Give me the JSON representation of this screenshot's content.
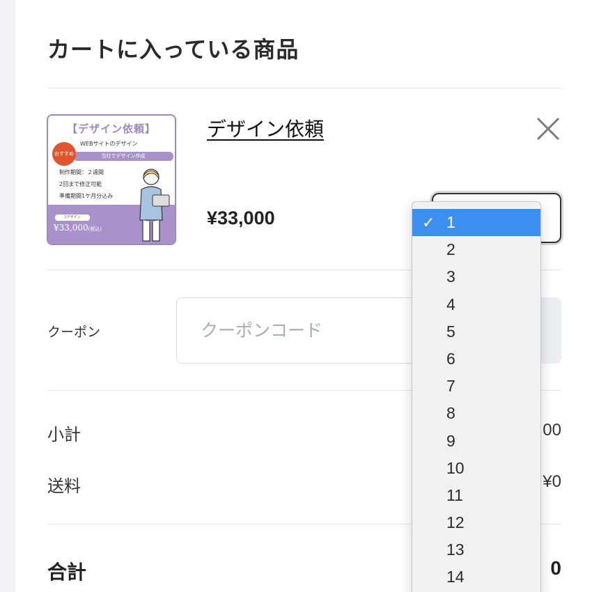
{
  "cart": {
    "title": "カートに入っている商品",
    "item": {
      "name": "デザイン依頼",
      "price": "¥33,000",
      "thumbnail": {
        "title": "【デザイン依頼】",
        "subtitle": "WEBサイトのデザイン",
        "badge": "おすすめ",
        "ribbon": "当社でデザイン作成",
        "line1": "制作期間：２週間",
        "line2": "2回まで修正可能",
        "line3": "準備期間1ケ月分込み",
        "pill": "1デザイン",
        "price": "¥33,000",
        "tax": "(税込)"
      },
      "remove_icon": "close-icon",
      "quantity": {
        "selected": "1",
        "options": [
          "1",
          "2",
          "3",
          "4",
          "5",
          "6",
          "7",
          "8",
          "9",
          "10",
          "11",
          "12",
          "13",
          "14"
        ]
      }
    },
    "coupon": {
      "label": "クーポン",
      "placeholder": "クーポンコード"
    },
    "summary": {
      "subtotal_label": "小計",
      "subtotal_value": "00",
      "shipping_label": "送料",
      "shipping_value": "¥0",
      "total_label": "合計",
      "total_value": "0"
    }
  },
  "colors": {
    "accent_purple": "#a892c9",
    "selected_blue": "#3c8ef0",
    "badge_red": "#e0552b"
  }
}
